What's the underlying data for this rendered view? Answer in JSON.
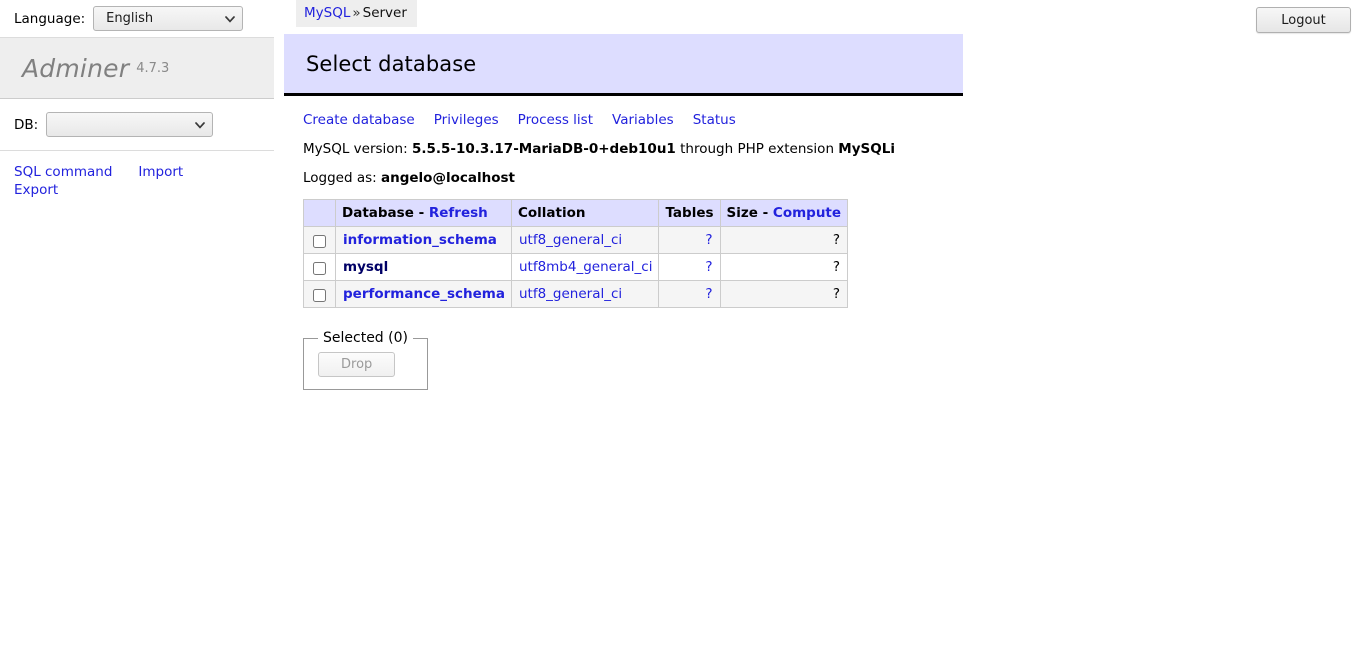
{
  "topbar": {
    "language_label": "Language:",
    "language_value": "English",
    "language_options": [
      "English"
    ],
    "logout_label": "Logout"
  },
  "sidebar": {
    "brand": "Adminer",
    "version": "4.7.3",
    "db_label": "DB:",
    "db_value": "",
    "db_options": [
      ""
    ],
    "links": [
      {
        "label": "SQL command"
      },
      {
        "label": "Import"
      },
      {
        "label": "Export"
      }
    ]
  },
  "breadcrumb": {
    "server": "MySQL",
    "separator": "»",
    "current": "Server"
  },
  "main": {
    "page_title": "Select database",
    "nav_links": [
      {
        "label": "Create database"
      },
      {
        "label": "Privileges"
      },
      {
        "label": "Process list"
      },
      {
        "label": "Variables"
      },
      {
        "label": "Status"
      }
    ],
    "version_line": {
      "prefix": "MySQL version:",
      "version": "5.5.5-10.3.17-MariaDB-0+deb10u1",
      "middle": "through PHP extension",
      "extension": "MySQLi"
    },
    "logged_line": {
      "prefix": "Logged as:",
      "user": "angelo@localhost"
    },
    "table": {
      "headers": {
        "database": "Database",
        "database_sep": "-",
        "refresh": "Refresh",
        "collation": "Collation",
        "tables": "Tables",
        "size": "Size",
        "size_sep": "-",
        "compute": "Compute"
      },
      "rows": [
        {
          "name": "information_schema",
          "name_link": true,
          "collation": "utf8_general_ci",
          "tables": "?",
          "size": "?"
        },
        {
          "name": "mysql",
          "name_link": false,
          "collation": "utf8mb4_general_ci",
          "tables": "?",
          "size": "?"
        },
        {
          "name": "performance_schema",
          "name_link": true,
          "collation": "utf8_general_ci",
          "tables": "?",
          "size": "?"
        }
      ]
    },
    "selected_fieldset": {
      "legend": "Selected (0)",
      "drop_label": "Drop"
    }
  },
  "colors": {
    "link": "#2222dd",
    "visited_link": "#000066",
    "panel_accent": "#ddddff",
    "sidebar_logo_bg": "#eeeeee",
    "row_stripe": "#f5f5f5"
  }
}
